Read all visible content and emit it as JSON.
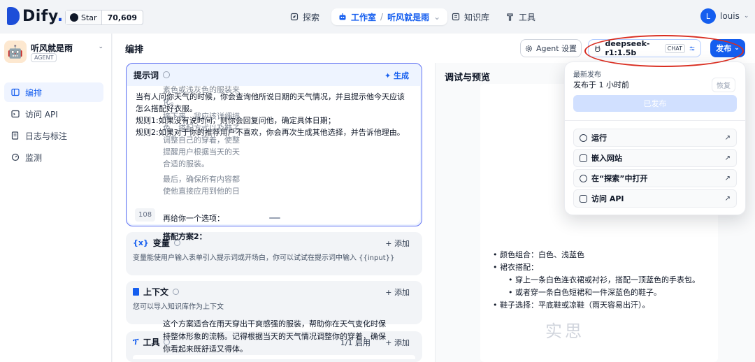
{
  "brand": {
    "name": "Dify",
    "dot": "."
  },
  "github": {
    "star_label": "Star",
    "star_count": "70,609"
  },
  "nav": {
    "explore": "探索",
    "studio": "工作室",
    "app_name": "听风就是雨",
    "knowledge": "知识库",
    "tools": "工具"
  },
  "user": {
    "initial": "L",
    "name": "louis"
  },
  "app": {
    "name": "听风就是雨",
    "type": "AGENT"
  },
  "sidebar": {
    "items": [
      {
        "label": "编排",
        "icon": "layout-icon"
      },
      {
        "label": "访问 API",
        "icon": "terminal-icon"
      },
      {
        "label": "日志与标注",
        "icon": "document-icon"
      },
      {
        "label": "监测",
        "icon": "gauge-icon"
      }
    ]
  },
  "main": {
    "title": "编排",
    "agent_settings": "Agent 设置",
    "model_name": "deepseek-r1:1.5b",
    "model_mode": "CHAT",
    "publish": "发布"
  },
  "prompt": {
    "title": "提示词",
    "generate": "生成",
    "lines": [
      "当有人问你天气的时候，你会查询他所说日期的天气情况，并且提示他今天应该怎么搭配好衣服。",
      "规则1:如果没有说时间，则你会回复问他，确定具体日期；",
      "规则2:如果对于你的推荐用户不喜欢，你会再次生成其他选择，并告诉他理由。"
    ],
    "count": "108"
  },
  "variables": {
    "title": "变量",
    "add": "+ 添加",
    "desc": "变量能使用户输入表单引入提示词或开场白，你可以试试在提示词中输入 {{input}}"
  },
  "context": {
    "title": "上下文",
    "add": "+ 添加",
    "desc": "您可以导入知识库作为上下文"
  },
  "tools_block": {
    "title": "工具",
    "enabled": "1/1 启用",
    "add": "+ 添加"
  },
  "debug": {
    "title": "调试与预览",
    "faded_1": [
      "紊色或浅灰色的服装来",
      "化。"
    ],
    "faded_2": [
      "接下来，我应该详细描",
      "色、搭配方式以及鞋子",
      "调整自己的穿着，使整",
      "提醒用户根据当天的天",
      "合适的服装。"
    ],
    "faded_3": [
      "最后，确保所有内容都",
      "使他直接应用到他的日"
    ],
    "intro": "再给你一个选项：",
    "plan_title": "搭配方案2：",
    "bullets": [
      "颜色组合：白色、浅蓝色",
      "裙衣搭配：",
      "穿上一条白色连衣裙或衬衫，搭配一顶蓝色的手表包。",
      "或者穿一条白色短裙和一件深蓝色的鞋子。",
      "鞋子选择：平底鞋或凉鞋（雨天容易出汗）。"
    ],
    "summary": [
      "这个方案适合在雨天穿出干爽感强的服装，帮助你在天气变化时保",
      "持整体形象的流畅。记得根据当天的天气情况调整你的穿着，确保",
      "你看起来既舒适又得体。"
    ],
    "watermark": "实思"
  },
  "publish_menu": {
    "latest_label": "最新发布",
    "published_time": "发布于 1 小时前",
    "restore": "恢复",
    "published_btn": "已发布",
    "items": [
      {
        "label": "运行",
        "icon": "play-icon"
      },
      {
        "label": "嵌入网站",
        "icon": "embed-icon"
      },
      {
        "label": "在“探索”中打开",
        "icon": "compass-icon"
      },
      {
        "label": "访问 API",
        "icon": "api-doc-icon"
      }
    ],
    "arrow": "↗"
  },
  "colors": {
    "accent": "#155eef",
    "highlight": "#d92d20"
  }
}
